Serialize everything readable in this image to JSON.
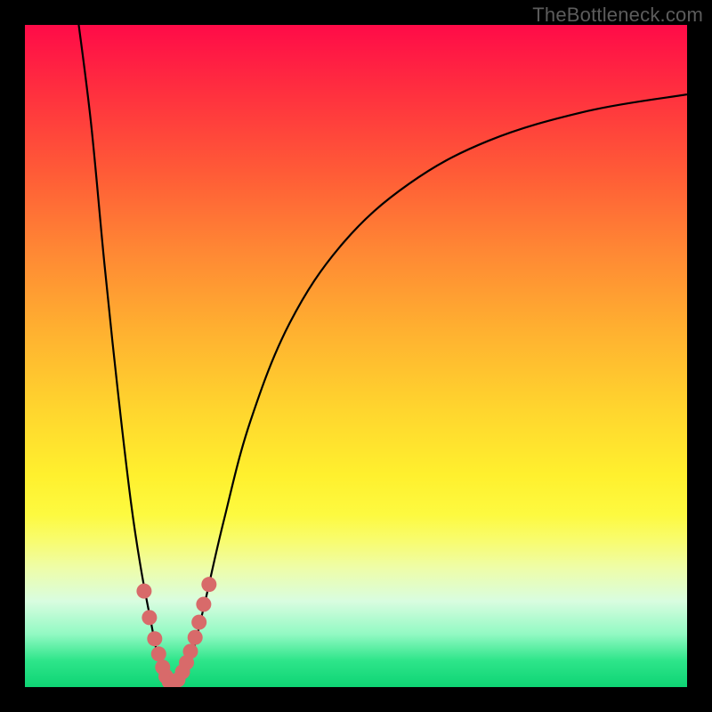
{
  "watermark": "TheBottleneck.com",
  "colors": {
    "frame": "#000000",
    "gradient_top": "#ff0b48",
    "gradient_bottom": "#0ed474",
    "curve": "#000000",
    "dots": "#d86a6a"
  },
  "chart_data": {
    "type": "line",
    "title": "",
    "xlabel": "",
    "ylabel": "",
    "xlim": [
      0,
      100
    ],
    "ylim": [
      0,
      100
    ],
    "grid": false,
    "legend": false,
    "note": "No tick labels or axis numerals are rendered in the image; curve values are estimated from pixel positions. y is plotted with 0 at the bottom.",
    "series": [
      {
        "name": "left-branch",
        "x": [
          8,
          10,
          12,
          14,
          16,
          17.5,
          19,
          20,
          21,
          21.8
        ],
        "y": [
          101,
          85,
          64,
          45,
          28,
          18,
          10,
          5,
          2,
          0.5
        ]
      },
      {
        "name": "right-branch",
        "x": [
          23.5,
          25,
          27,
          30,
          34,
          40,
          48,
          58,
          70,
          85,
          100
        ],
        "y": [
          0.5,
          4,
          12,
          25,
          40,
          55,
          67,
          76,
          82.5,
          87,
          89.5
        ]
      }
    ],
    "points": {
      "name": "highlight-dots",
      "x": [
        18.0,
        18.8,
        19.6,
        20.2,
        20.8,
        21.3,
        21.8,
        22.5,
        23.1,
        23.8,
        24.4,
        25.0,
        25.7,
        26.3,
        27.0,
        27.8
      ],
      "y": [
        14.5,
        10.5,
        7.3,
        5.0,
        3.0,
        1.6,
        0.8,
        0.6,
        1.1,
        2.3,
        3.7,
        5.4,
        7.5,
        9.8,
        12.5,
        15.5
      ]
    }
  }
}
